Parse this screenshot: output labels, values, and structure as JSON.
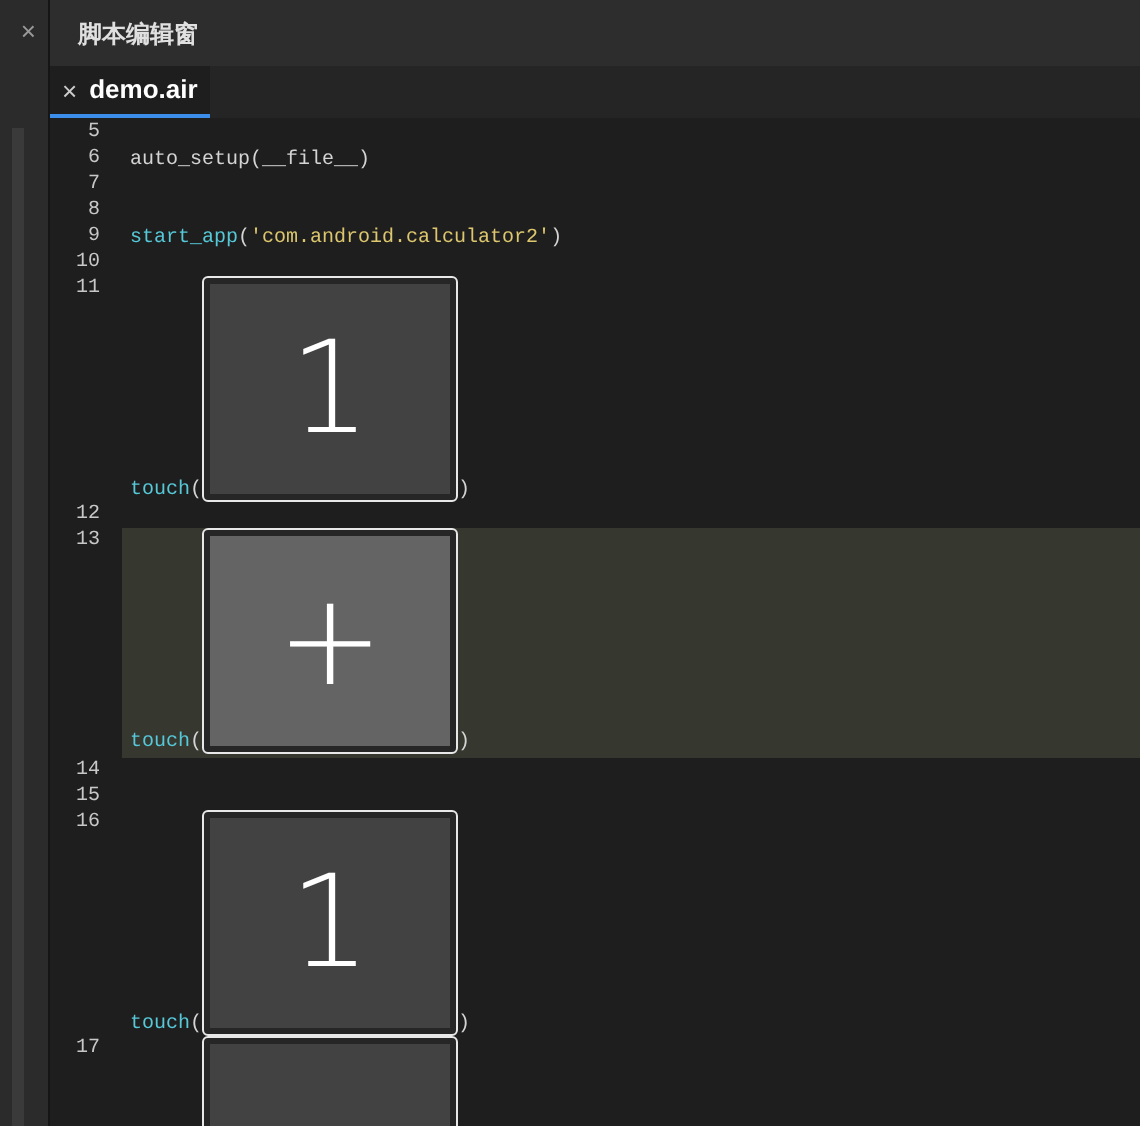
{
  "side_panel": {
    "close": "×"
  },
  "editor": {
    "title": "脚本编辑窗",
    "tabs": [
      {
        "label": "demo.air",
        "close": "×",
        "selected": true
      }
    ],
    "lines": [
      {
        "number": "5",
        "kind": "text",
        "highlighted": false
      },
      {
        "number": "6",
        "kind": "text",
        "highlighted": false,
        "tokens": [
          {
            "kind": "plain",
            "text": "auto_setup(__file__)"
          }
        ]
      },
      {
        "number": "7",
        "kind": "text",
        "highlighted": false
      },
      {
        "number": "8",
        "kind": "text",
        "highlighted": false
      },
      {
        "number": "9",
        "kind": "text",
        "highlighted": false,
        "tokens": [
          {
            "kind": "func",
            "text": "start_app"
          },
          {
            "kind": "plain",
            "text": "("
          },
          {
            "kind": "string",
            "text": "'com.android.calculator2'"
          },
          {
            "kind": "plain",
            "text": ")"
          }
        ]
      },
      {
        "number": "10",
        "kind": "text",
        "highlighted": false
      },
      {
        "number": "11",
        "kind": "image",
        "highlighted": false,
        "call": "touch",
        "open": "(",
        "close": ")",
        "label": "1",
        "color": "#424242"
      },
      {
        "number": "12",
        "kind": "text",
        "highlighted": false
      },
      {
        "number": "13",
        "kind": "image",
        "highlighted": true,
        "call": "touch",
        "open": "(",
        "close": ")",
        "label": "+",
        "color": "#646464"
      },
      {
        "number": "14",
        "kind": "text",
        "highlighted": false
      },
      {
        "number": "15",
        "kind": "text",
        "highlighted": false
      },
      {
        "number": "16",
        "kind": "image",
        "highlighted": false,
        "call": "touch",
        "open": "(",
        "close": ")",
        "label": "1",
        "color": "#424242"
      },
      {
        "number": "17",
        "kind": "image",
        "highlighted": false,
        "color": "#424242"
      }
    ]
  }
}
